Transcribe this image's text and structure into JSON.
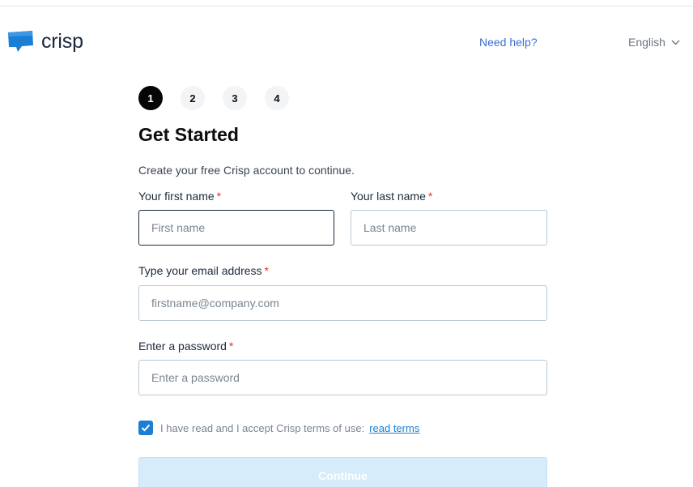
{
  "header": {
    "brand": "crisp",
    "help_link": "Need help?",
    "language": "English"
  },
  "steps": [
    "1",
    "2",
    "3",
    "4"
  ],
  "active_step": 1,
  "form": {
    "title": "Get Started",
    "subtitle": "Create your free Crisp account to continue.",
    "required_marker": "*",
    "first_name": {
      "label": "Your first name",
      "placeholder": "First name",
      "value": ""
    },
    "last_name": {
      "label": "Your last name",
      "placeholder": "Last name",
      "value": ""
    },
    "email": {
      "label": "Type your email address",
      "placeholder": "firstname@company.com",
      "value": ""
    },
    "password": {
      "label": "Enter a password",
      "placeholder": "Enter a password",
      "value": ""
    },
    "terms": {
      "checked": true,
      "text": "I have read and I accept Crisp terms of use:",
      "link": "read terms"
    },
    "continue_label": "Continue"
  },
  "colors": {
    "brand_blue": "#1a7fd4",
    "link_blue": "#3a6fd0",
    "required_red": "#e0342a",
    "button_disabled": "#d6ecfa"
  }
}
